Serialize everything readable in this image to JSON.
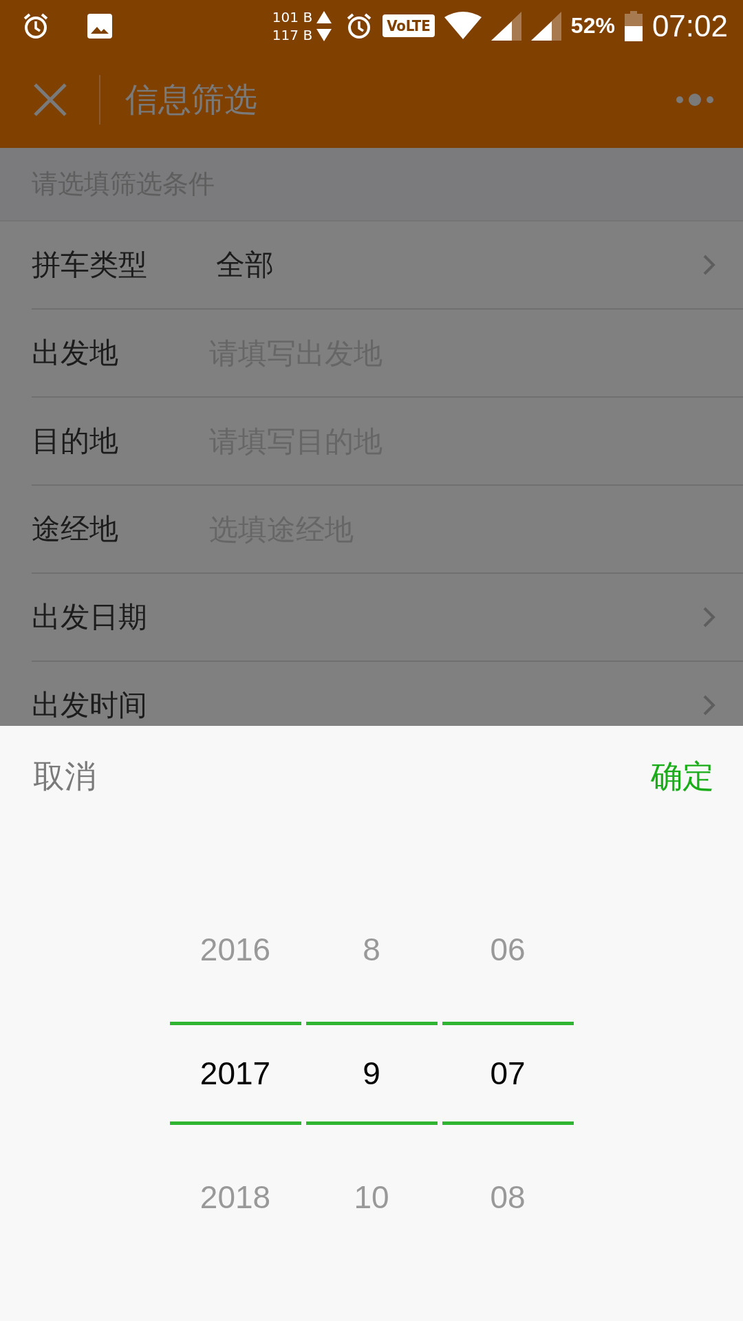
{
  "status_bar": {
    "net_up": "101 B",
    "net_down": "117 B",
    "volte": "VoLTE",
    "battery_percent": "52%",
    "time": "07:02"
  },
  "header": {
    "title": "信息筛选"
  },
  "form": {
    "hint": "请选填筛选条件",
    "rows": [
      {
        "kind": "select",
        "label": "拼车类型",
        "value": "全部"
      },
      {
        "kind": "input",
        "label": "出发地",
        "placeholder": "请填写出发地"
      },
      {
        "kind": "input",
        "label": "目的地",
        "placeholder": "请填写目的地"
      },
      {
        "kind": "input",
        "label": "途经地",
        "placeholder": "选填途经地"
      },
      {
        "kind": "select",
        "label": "出发日期"
      },
      {
        "kind": "select",
        "label": "出发时间"
      }
    ]
  },
  "picker": {
    "cancel": "取消",
    "confirm": "确定",
    "columns": [
      {
        "items": [
          {
            "text": "2016",
            "selected": false
          },
          {
            "text": "2017",
            "selected": true
          },
          {
            "text": "2018",
            "selected": false
          }
        ]
      },
      {
        "items": [
          {
            "text": "8",
            "selected": false
          },
          {
            "text": "9",
            "selected": true
          },
          {
            "text": "10",
            "selected": false
          }
        ]
      },
      {
        "items": [
          {
            "text": "06",
            "selected": false
          },
          {
            "text": "07",
            "selected": true
          },
          {
            "text": "08",
            "selected": false
          }
        ]
      }
    ]
  }
}
